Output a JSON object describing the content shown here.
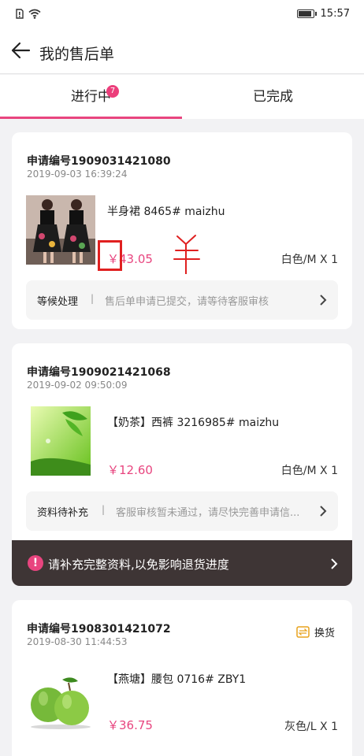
{
  "status_bar": {
    "time": "15:57",
    "icons": [
      "sim-icon",
      "wifi-icon",
      "battery-icon"
    ]
  },
  "header": {
    "title": "我的售后单",
    "back_icon": "back-arrow-icon"
  },
  "tabs": [
    {
      "label": "进行中",
      "badge": "7",
      "active": true
    },
    {
      "label": "已完成",
      "active": false
    }
  ],
  "orders": [
    {
      "order_no": "申请编号1909031421080",
      "time": "2019-09-03 16:39:24",
      "product_name": "半身裙 8465# maizhu",
      "price": "￥43.05",
      "spec": "白色/M X 1",
      "status_label": "等候处理",
      "status_desc": "售后单申请已提交，请等待客服审核"
    },
    {
      "order_no": "申请编号1909021421068",
      "time": "2019-09-02 09:50:09",
      "product_name": "【奶茶】西裤 3216985# maizhu",
      "price": "￥12.60",
      "spec": "白色/M X 1",
      "status_label": "资料待补充",
      "status_desc": "客服审核暂未通过，请尽快完善申请信...",
      "alert": "请补充完整资料,以免影响退货进度"
    },
    {
      "order_no": "申请编号1908301421072",
      "time": "2019-08-30 11:44:53",
      "badge": "换货",
      "product_name": "【燕塘】腰包 0716# ZBY1",
      "price": "￥36.75",
      "spec": "灰色/L X 1"
    }
  ],
  "colors": {
    "accent": "#e8457f",
    "alert_bg": "#3e3535",
    "annotation": "#e02020"
  }
}
